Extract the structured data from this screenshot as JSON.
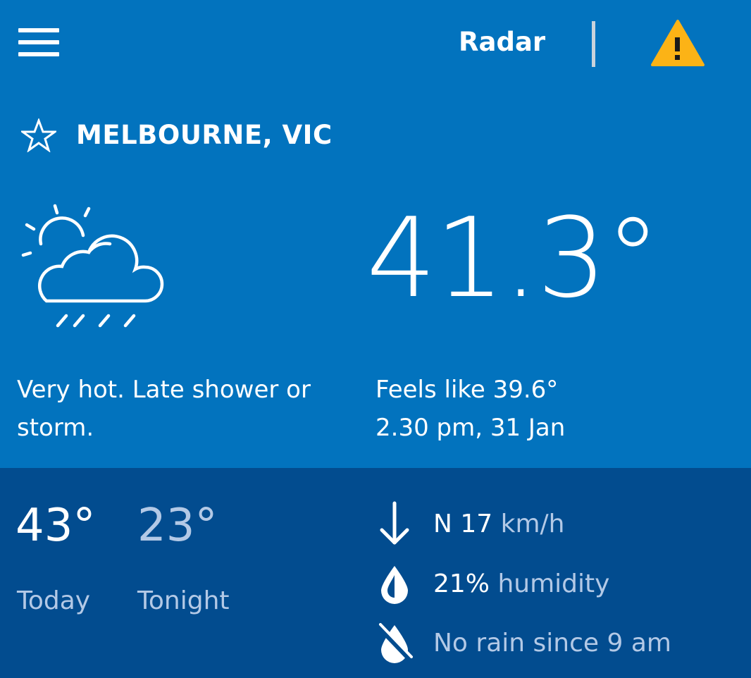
{
  "header": {
    "radar_label": "Radar",
    "menu_icon": "hamburger-menu-icon",
    "warning_icon": "warning-triangle-icon"
  },
  "location": {
    "name": "MELBOURNE, VIC",
    "favourite_icon": "star-outline-icon"
  },
  "current": {
    "condition_icon": "partly-cloudy-showers-icon",
    "temperature": "41.3°",
    "forecast": "Very hot. Late shower or storm.",
    "feels_like": "Feels like 39.6°",
    "observed": "2.30 pm, 31 Jan"
  },
  "daily": {
    "today_temp": "43°",
    "today_label": "Today",
    "tonight_temp": "23°",
    "tonight_label": "Tonight"
  },
  "details": {
    "wind_value": "N 17",
    "wind_unit": "km/h",
    "humidity_value": "21%",
    "humidity_unit": "humidity",
    "rain_text": "No rain since 9 am"
  },
  "colors": {
    "primary_bg": "#0273be",
    "secondary_bg": "#024c8f",
    "muted_text": "#b3c9e6",
    "warning": "#fcb316"
  }
}
